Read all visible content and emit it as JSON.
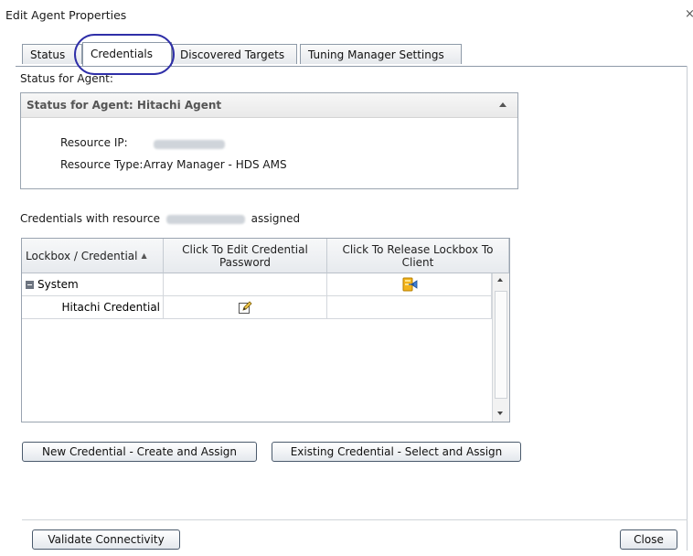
{
  "window": {
    "title": "Edit Agent Properties",
    "close_glyph": "×"
  },
  "tabs": [
    {
      "label": "Status",
      "active": false
    },
    {
      "label": "Credentials",
      "active": true
    },
    {
      "label": "Discovered Targets",
      "active": false
    },
    {
      "label": "Tuning Manager Settings",
      "active": false
    }
  ],
  "status_section": {
    "label": "Status for Agent:",
    "header_prefix": "Status for Agent:",
    "header_agent": "Hitachi Agent",
    "resource_ip_label": "Resource IP:",
    "resource_type_label": "Resource Type:",
    "resource_type_value": "Array Manager - HDS AMS"
  },
  "credentials_line": {
    "prefix": "Credentials with resource",
    "suffix": "assigned"
  },
  "grid": {
    "columns": [
      "Lockbox / Credential",
      "Click To Edit Credential Password",
      "Click To Release Lockbox To Client"
    ],
    "sort_glyph": "▲",
    "rows": [
      {
        "label": "System",
        "type": "group",
        "expand_glyph": "⊟"
      },
      {
        "label": "Hitachi Credential",
        "type": "item"
      }
    ]
  },
  "buttons": {
    "new_credential": "New Credential - Create and Assign",
    "existing_credential": "Existing Credential - Select and Assign",
    "validate": "Validate Connectivity",
    "close": "Close"
  },
  "colors": {
    "accent_ring": "#2f2fa8",
    "lockbox_icon": "#f2b31b",
    "border": "#9aa4b0"
  }
}
